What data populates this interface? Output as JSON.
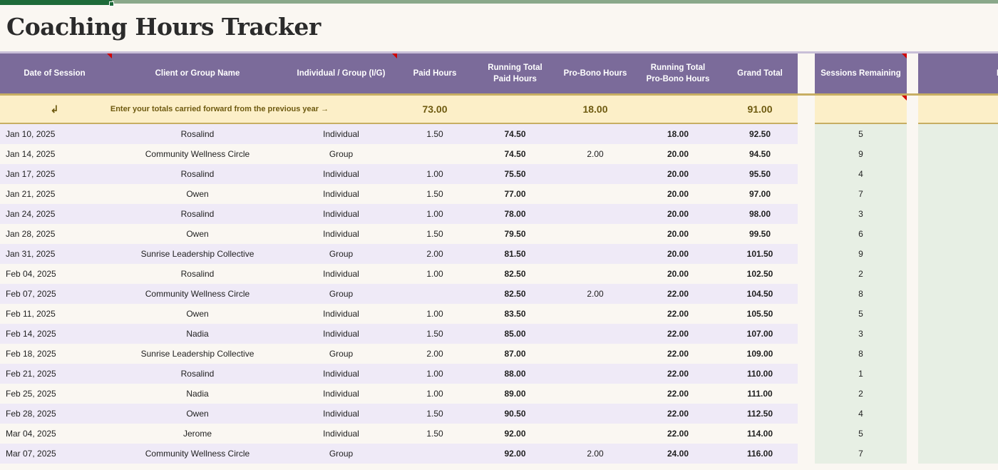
{
  "title": "Coaching Hours Tracker",
  "headers": {
    "date": "Date of Session",
    "client": "Client or Group Name",
    "type": "Individual / Group (I/G)",
    "paid": "Paid Hours",
    "running_paid_1": "Running Total",
    "running_paid_2": "Paid Hours",
    "probono": "Pro-Bono Hours",
    "running_pb_1": "Running Total",
    "running_pb_2": "Pro-Bono Hours",
    "grand": "Grand Total",
    "sessions": "Sessions Remaining",
    "notes": "No"
  },
  "carry": {
    "arrow": "↲",
    "text": "Enter your totals carried forward from the previous year →",
    "paid": "73.00",
    "probono": "18.00",
    "grand": "91.00"
  },
  "rows": [
    {
      "date": "Jan 10, 2025",
      "client": "Rosalind",
      "type": "Individual",
      "paid": "1.50",
      "run_paid": "74.50",
      "probono": "",
      "run_pb": "18.00",
      "grand": "92.50",
      "sessions": "5"
    },
    {
      "date": "Jan 14, 2025",
      "client": "Community Wellness Circle",
      "type": "Group",
      "paid": "",
      "run_paid": "74.50",
      "probono": "2.00",
      "run_pb": "20.00",
      "grand": "94.50",
      "sessions": "9"
    },
    {
      "date": "Jan 17, 2025",
      "client": "Rosalind",
      "type": "Individual",
      "paid": "1.00",
      "run_paid": "75.50",
      "probono": "",
      "run_pb": "20.00",
      "grand": "95.50",
      "sessions": "4"
    },
    {
      "date": "Jan 21, 2025",
      "client": "Owen",
      "type": "Individual",
      "paid": "1.50",
      "run_paid": "77.00",
      "probono": "",
      "run_pb": "20.00",
      "grand": "97.00",
      "sessions": "7"
    },
    {
      "date": "Jan 24, 2025",
      "client": "Rosalind",
      "type": "Individual",
      "paid": "1.00",
      "run_paid": "78.00",
      "probono": "",
      "run_pb": "20.00",
      "grand": "98.00",
      "sessions": "3"
    },
    {
      "date": "Jan 28, 2025",
      "client": "Owen",
      "type": "Individual",
      "paid": "1.50",
      "run_paid": "79.50",
      "probono": "",
      "run_pb": "20.00",
      "grand": "99.50",
      "sessions": "6"
    },
    {
      "date": "Jan 31, 2025",
      "client": "Sunrise Leadership Collective",
      "type": "Group",
      "paid": "2.00",
      "run_paid": "81.50",
      "probono": "",
      "run_pb": "20.00",
      "grand": "101.50",
      "sessions": "9"
    },
    {
      "date": "Feb 04, 2025",
      "client": "Rosalind",
      "type": "Individual",
      "paid": "1.00",
      "run_paid": "82.50",
      "probono": "",
      "run_pb": "20.00",
      "grand": "102.50",
      "sessions": "2"
    },
    {
      "date": "Feb 07, 2025",
      "client": "Community Wellness Circle",
      "type": "Group",
      "paid": "",
      "run_paid": "82.50",
      "probono": "2.00",
      "run_pb": "22.00",
      "grand": "104.50",
      "sessions": "8"
    },
    {
      "date": "Feb 11, 2025",
      "client": "Owen",
      "type": "Individual",
      "paid": "1.00",
      "run_paid": "83.50",
      "probono": "",
      "run_pb": "22.00",
      "grand": "105.50",
      "sessions": "5"
    },
    {
      "date": "Feb 14, 2025",
      "client": "Nadia",
      "type": "Individual",
      "paid": "1.50",
      "run_paid": "85.00",
      "probono": "",
      "run_pb": "22.00",
      "grand": "107.00",
      "sessions": "3"
    },
    {
      "date": "Feb 18, 2025",
      "client": "Sunrise Leadership Collective",
      "type": "Group",
      "paid": "2.00",
      "run_paid": "87.00",
      "probono": "",
      "run_pb": "22.00",
      "grand": "109.00",
      "sessions": "8"
    },
    {
      "date": "Feb 21, 2025",
      "client": "Rosalind",
      "type": "Individual",
      "paid": "1.00",
      "run_paid": "88.00",
      "probono": "",
      "run_pb": "22.00",
      "grand": "110.00",
      "sessions": "1"
    },
    {
      "date": "Feb 25, 2025",
      "client": "Nadia",
      "type": "Individual",
      "paid": "1.00",
      "run_paid": "89.00",
      "probono": "",
      "run_pb": "22.00",
      "grand": "111.00",
      "sessions": "2"
    },
    {
      "date": "Feb 28, 2025",
      "client": "Owen",
      "type": "Individual",
      "paid": "1.50",
      "run_paid": "90.50",
      "probono": "",
      "run_pb": "22.00",
      "grand": "112.50",
      "sessions": "4"
    },
    {
      "date": "Mar 04, 2025",
      "client": "Jerome",
      "type": "Individual",
      "paid": "1.50",
      "run_paid": "92.00",
      "probono": "",
      "run_pb": "22.00",
      "grand": "114.00",
      "sessions": "5"
    },
    {
      "date": "Mar 07, 2025",
      "client": "Community Wellness Circle",
      "type": "Group",
      "paid": "",
      "run_paid": "92.00",
      "probono": "2.00",
      "run_pb": "24.00",
      "grand": "116.00",
      "sessions": "7"
    }
  ]
}
